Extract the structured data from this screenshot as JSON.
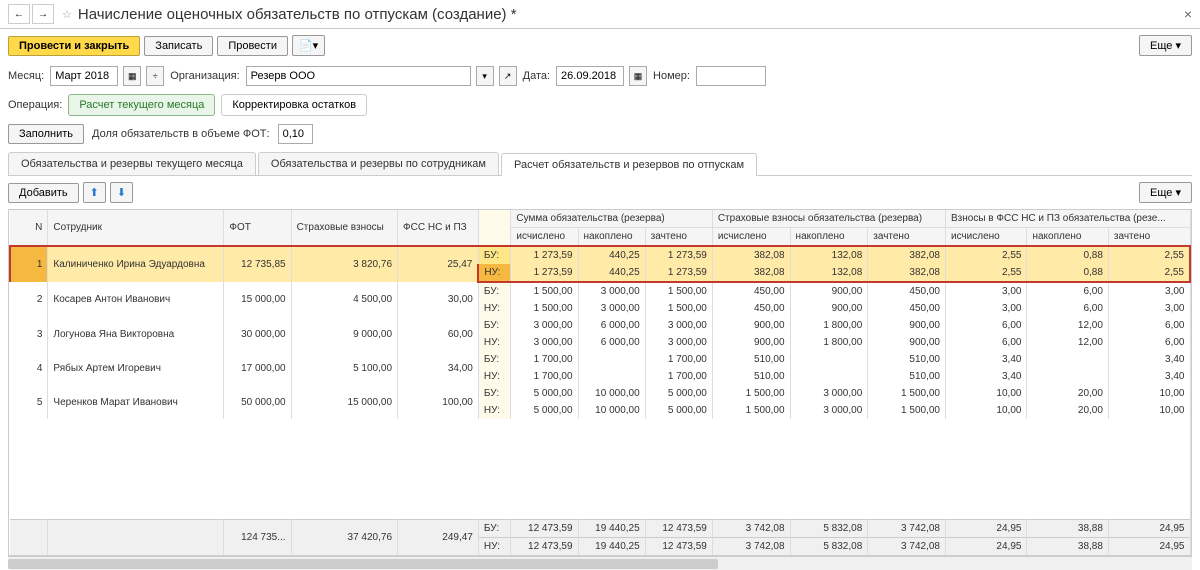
{
  "header": {
    "title": "Начисление оценочных обязательств по отпускам (создание) *"
  },
  "toolbar": {
    "post_close": "Провести и закрыть",
    "write": "Записать",
    "post": "Провести",
    "more": "Еще"
  },
  "form": {
    "month_lbl": "Месяц:",
    "month_val": "Март 2018",
    "org_lbl": "Организация:",
    "org_val": "Резерв ООО",
    "date_lbl": "Дата:",
    "date_val": "26.09.2018",
    "num_lbl": "Номер:",
    "num_val": ""
  },
  "ops": {
    "lbl": "Операция:",
    "calc": "Расчет текущего месяца",
    "corr": "Корректировка остатков"
  },
  "fill": {
    "btn": "Заполнить",
    "share_lbl": "Доля обязательств в объеме ФОТ:",
    "share_val": "0,10"
  },
  "tabs": {
    "t1": "Обязательства и резервы текущего месяца",
    "t2": "Обязательства и резервы по сотрудникам",
    "t3": "Расчет обязательств и резервов по отпускам"
  },
  "subtb": {
    "add": "Добавить",
    "more": "Еще"
  },
  "cols": {
    "n": "N",
    "emp": "Сотрудник",
    "fot": "ФОТ",
    "sv": "Страховые взносы",
    "fss": "ФСС НС и ПЗ",
    "g1": "Сумма обязательства (резерва)",
    "g2": "Страховые взносы обязательства (резерва)",
    "g3": "Взносы в ФСС НС и ПЗ обязательства (резе...",
    "sub1": "исчислено",
    "sub2": "накоплено",
    "sub3": "зачтено"
  },
  "rows": [
    {
      "n": "1",
      "emp": "Калиниченко Ирина Эдуардовна",
      "fot": "12 735,85",
      "sv": "3 820,76",
      "fss": "25,47",
      "bu": [
        "1 273,59",
        "440,25",
        "1 273,59",
        "382,08",
        "132,08",
        "382,08",
        "2,55",
        "0,88",
        "2,55"
      ],
      "nu": [
        "1 273,59",
        "440,25",
        "1 273,59",
        "382,08",
        "132,08",
        "382,08",
        "2,55",
        "0,88",
        "2,55"
      ]
    },
    {
      "n": "2",
      "emp": "Косарев Антон Иванович",
      "fot": "15 000,00",
      "sv": "4 500,00",
      "fss": "30,00",
      "bu": [
        "1 500,00",
        "3 000,00",
        "1 500,00",
        "450,00",
        "900,00",
        "450,00",
        "3,00",
        "6,00",
        "3,00"
      ],
      "nu": [
        "1 500,00",
        "3 000,00",
        "1 500,00",
        "450,00",
        "900,00",
        "450,00",
        "3,00",
        "6,00",
        "3,00"
      ]
    },
    {
      "n": "3",
      "emp": "Логунова Яна Викторовна",
      "fot": "30 000,00",
      "sv": "9 000,00",
      "fss": "60,00",
      "bu": [
        "3 000,00",
        "6 000,00",
        "3 000,00",
        "900,00",
        "1 800,00",
        "900,00",
        "6,00",
        "12,00",
        "6,00"
      ],
      "nu": [
        "3 000,00",
        "6 000,00",
        "3 000,00",
        "900,00",
        "1 800,00",
        "900,00",
        "6,00",
        "12,00",
        "6,00"
      ]
    },
    {
      "n": "4",
      "emp": "Рябых Артем Игоревич",
      "fot": "17 000,00",
      "sv": "5 100,00",
      "fss": "34,00",
      "bu": [
        "1 700,00",
        "",
        "1 700,00",
        "510,00",
        "",
        "510,00",
        "3,40",
        "",
        "3,40"
      ],
      "nu": [
        "1 700,00",
        "",
        "1 700,00",
        "510,00",
        "",
        "510,00",
        "3,40",
        "",
        "3,40"
      ]
    },
    {
      "n": "5",
      "emp": "Черенков Марат Иванович",
      "fot": "50 000,00",
      "sv": "15 000,00",
      "fss": "100,00",
      "bu": [
        "5 000,00",
        "10 000,00",
        "5 000,00",
        "1 500,00",
        "3 000,00",
        "1 500,00",
        "10,00",
        "20,00",
        "10,00"
      ],
      "nu": [
        "5 000,00",
        "10 000,00",
        "5 000,00",
        "1 500,00",
        "3 000,00",
        "1 500,00",
        "10,00",
        "20,00",
        "10,00"
      ]
    }
  ],
  "totals": {
    "fot": "124 735...",
    "sv": "37 420,76",
    "fss": "249,47",
    "bu": [
      "12 473,59",
      "19 440,25",
      "12 473,59",
      "3 742,08",
      "5 832,08",
      "3 742,08",
      "24,95",
      "38,88",
      "24,95"
    ],
    "nu": [
      "12 473,59",
      "19 440,25",
      "12 473,59",
      "3 742,08",
      "5 832,08",
      "3 742,08",
      "24,95",
      "38,88",
      "24,95"
    ]
  },
  "bn": {
    "bu": "БУ:",
    "nu": "НУ:"
  }
}
